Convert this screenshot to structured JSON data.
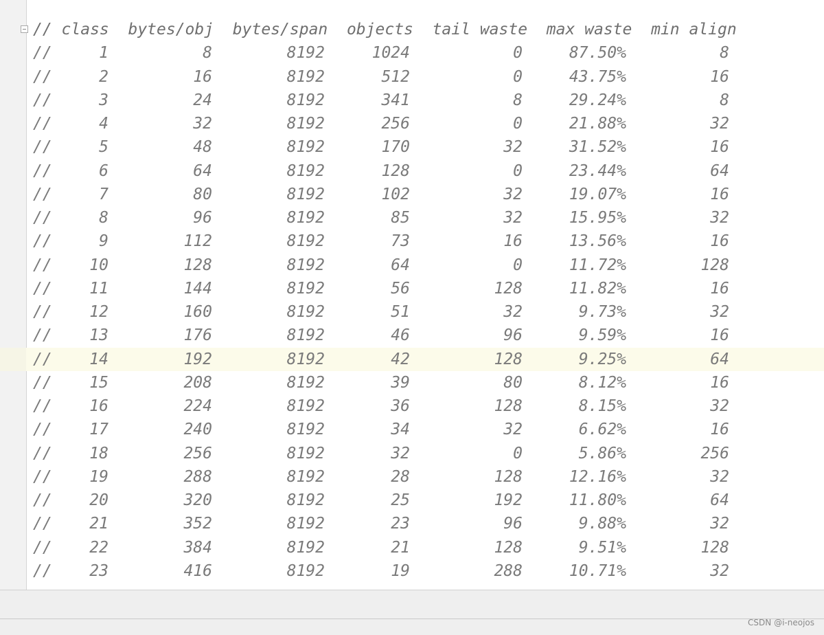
{
  "header": {
    "text": "// class  bytes/obj  bytes/span  objects  tail waste  max waste  min align"
  },
  "rows": [
    {
      "comment": "//",
      "class": "1",
      "bytes": "8",
      "span": "8192",
      "objs": "1024",
      "tail": "0",
      "maxw": "87.50%",
      "align": "8"
    },
    {
      "comment": "//",
      "class": "2",
      "bytes": "16",
      "span": "8192",
      "objs": "512",
      "tail": "0",
      "maxw": "43.75%",
      "align": "16"
    },
    {
      "comment": "//",
      "class": "3",
      "bytes": "24",
      "span": "8192",
      "objs": "341",
      "tail": "8",
      "maxw": "29.24%",
      "align": "8"
    },
    {
      "comment": "//",
      "class": "4",
      "bytes": "32",
      "span": "8192",
      "objs": "256",
      "tail": "0",
      "maxw": "21.88%",
      "align": "32"
    },
    {
      "comment": "//",
      "class": "5",
      "bytes": "48",
      "span": "8192",
      "objs": "170",
      "tail": "32",
      "maxw": "31.52%",
      "align": "16"
    },
    {
      "comment": "//",
      "class": "6",
      "bytes": "64",
      "span": "8192",
      "objs": "128",
      "tail": "0",
      "maxw": "23.44%",
      "align": "64"
    },
    {
      "comment": "//",
      "class": "7",
      "bytes": "80",
      "span": "8192",
      "objs": "102",
      "tail": "32",
      "maxw": "19.07%",
      "align": "16"
    },
    {
      "comment": "//",
      "class": "8",
      "bytes": "96",
      "span": "8192",
      "objs": "85",
      "tail": "32",
      "maxw": "15.95%",
      "align": "32"
    },
    {
      "comment": "//",
      "class": "9",
      "bytes": "112",
      "span": "8192",
      "objs": "73",
      "tail": "16",
      "maxw": "13.56%",
      "align": "16"
    },
    {
      "comment": "//",
      "class": "10",
      "bytes": "128",
      "span": "8192",
      "objs": "64",
      "tail": "0",
      "maxw": "11.72%",
      "align": "128"
    },
    {
      "comment": "//",
      "class": "11",
      "bytes": "144",
      "span": "8192",
      "objs": "56",
      "tail": "128",
      "maxw": "11.82%",
      "align": "16"
    },
    {
      "comment": "//",
      "class": "12",
      "bytes": "160",
      "span": "8192",
      "objs": "51",
      "tail": "32",
      "maxw": "9.73%",
      "align": "32"
    },
    {
      "comment": "//",
      "class": "13",
      "bytes": "176",
      "span": "8192",
      "objs": "46",
      "tail": "96",
      "maxw": "9.59%",
      "align": "16"
    },
    {
      "comment": "//",
      "class": "14",
      "bytes": "192",
      "span": "8192",
      "objs": "42",
      "tail": "128",
      "maxw": "9.25%",
      "align": "64"
    },
    {
      "comment": "//",
      "class": "15",
      "bytes": "208",
      "span": "8192",
      "objs": "39",
      "tail": "80",
      "maxw": "8.12%",
      "align": "16"
    },
    {
      "comment": "//",
      "class": "16",
      "bytes": "224",
      "span": "8192",
      "objs": "36",
      "tail": "128",
      "maxw": "8.15%",
      "align": "32"
    },
    {
      "comment": "//",
      "class": "17",
      "bytes": "240",
      "span": "8192",
      "objs": "34",
      "tail": "32",
      "maxw": "6.62%",
      "align": "16"
    },
    {
      "comment": "//",
      "class": "18",
      "bytes": "256",
      "span": "8192",
      "objs": "32",
      "tail": "0",
      "maxw": "5.86%",
      "align": "256"
    },
    {
      "comment": "//",
      "class": "19",
      "bytes": "288",
      "span": "8192",
      "objs": "28",
      "tail": "128",
      "maxw": "12.16%",
      "align": "32"
    },
    {
      "comment": "//",
      "class": "20",
      "bytes": "320",
      "span": "8192",
      "objs": "25",
      "tail": "192",
      "maxw": "11.80%",
      "align": "64"
    },
    {
      "comment": "//",
      "class": "21",
      "bytes": "352",
      "span": "8192",
      "objs": "23",
      "tail": "96",
      "maxw": "9.88%",
      "align": "32"
    },
    {
      "comment": "//",
      "class": "22",
      "bytes": "384",
      "span": "8192",
      "objs": "21",
      "tail": "128",
      "maxw": "9.51%",
      "align": "128"
    },
    {
      "comment": "//",
      "class": "23",
      "bytes": "416",
      "span": "8192",
      "objs": "19",
      "tail": "288",
      "maxw": "10.71%",
      "align": "32"
    }
  ],
  "watermark": "CSDN @i-neojos"
}
